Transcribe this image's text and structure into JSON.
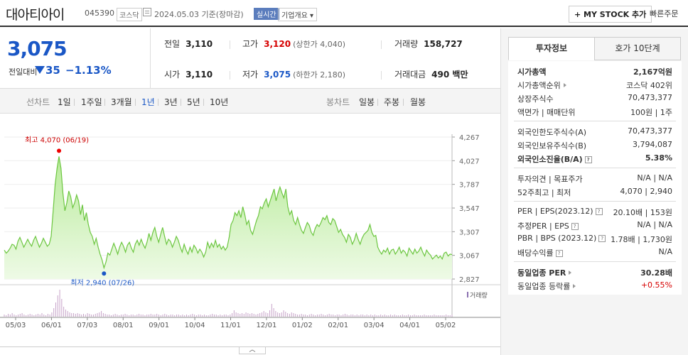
{
  "header": {
    "name": "대아티아이",
    "code": "045390",
    "market": "코스닥",
    "date": "2024.05.03",
    "basis": "기준(장마감)",
    "realtime": "실시간",
    "overview": "기업개요 ▾",
    "mystock": "+ MY STOCK 추가",
    "quick_order": "빠른주문"
  },
  "price": {
    "current": "3,075",
    "change_label": "전일대비",
    "change": "35",
    "change_pct": "−1.13%",
    "prev_label": "전일",
    "prev": "3,110",
    "high_label": "고가",
    "high": "3,120",
    "upper_limit": "(상한가 4,040)",
    "volume_label": "거래량",
    "volume": "158,727",
    "open_label": "시가",
    "open": "3,110",
    "low_label": "저가",
    "low": "3,075",
    "lower_limit": "(하한가 2,180)",
    "amount_label": "거래대금",
    "amount": "490 백만"
  },
  "periods": {
    "line_label": "선차트",
    "line": [
      "1일",
      "1주일",
      "3개월",
      "1년",
      "3년",
      "5년",
      "10년"
    ],
    "active": "1년",
    "candle_label": "봉차트",
    "candle": [
      "일봉",
      "주봉",
      "월봉"
    ]
  },
  "chart_data": {
    "type": "area",
    "y_ticks": [
      4267,
      4027,
      3787,
      3547,
      3307,
      3067,
      2827
    ],
    "ylim": [
      2827,
      4267
    ],
    "x_labels": [
      "05/03",
      "06/01",
      "07/03",
      "08/01",
      "09/01",
      "10/04",
      "11/01",
      "12/01",
      "01/02",
      "02/01",
      "03/04",
      "04/01",
      "05/02"
    ],
    "high_annotation": "최고 4,070 (06/19)",
    "low_annotation": "최저 2,940 (07/26)",
    "volume_legend": "거래량",
    "series": [
      {
        "name": "",
        "values": [
          3120,
          3090,
          3110,
          3140,
          3180,
          3170,
          3130,
          3210,
          3250,
          3200,
          3150,
          3190,
          3230,
          3190,
          3160,
          3220,
          3260,
          3200,
          3150,
          3190,
          3240,
          3200,
          3160,
          3180,
          3260,
          3520,
          3780,
          3950,
          4070,
          3950,
          3700,
          3520,
          3600,
          3720,
          3660,
          3550,
          3600,
          3680,
          3620,
          3480,
          3580,
          3420,
          3500,
          3380,
          3300,
          3260,
          3180,
          3240,
          3150,
          3080,
          3020,
          2940,
          3000,
          3090,
          3070,
          3130,
          3190,
          3140,
          3080,
          3150,
          3200,
          3160,
          3100,
          3170,
          3200,
          3140,
          3100,
          3180,
          3220,
          3170,
          3230,
          3180,
          3140,
          3200,
          3290,
          3220,
          3300,
          3350,
          3260,
          3200,
          3280,
          3350,
          3260,
          3180,
          3230,
          3210,
          3150,
          3200,
          3260,
          3220,
          3150,
          3100,
          3180,
          3120,
          3080,
          3150,
          3100,
          3170,
          3140,
          3090,
          3130,
          3100,
          3050,
          3100,
          3200,
          3140,
          3190,
          3150,
          3220,
          3150,
          3180,
          3130,
          3160,
          3120,
          3150,
          3250,
          3380,
          3420,
          3500,
          3470,
          3520,
          3450,
          3560,
          3480,
          3380,
          3420,
          3320,
          3280,
          3350,
          3420,
          3470,
          3560,
          3540,
          3600,
          3640,
          3560,
          3620,
          3680,
          3740,
          3620,
          3700,
          3760,
          3700,
          3650,
          3740,
          3560,
          3480,
          3520,
          3420,
          3380,
          3450,
          3380,
          3320,
          3290,
          3350,
          3400,
          3370,
          3300,
          3270,
          3340,
          3380,
          3360,
          3400,
          3450,
          3430,
          3470,
          3400,
          3380,
          3440,
          3420,
          3360,
          3300,
          3330,
          3280,
          3250,
          3200,
          3280,
          3250,
          3180,
          3220,
          3290,
          3230,
          3180,
          3240,
          3280,
          3300,
          3320,
          3380,
          3300,
          3260,
          3270,
          3150,
          3110,
          3080,
          3120,
          3100,
          3140,
          3080,
          3120,
          3130,
          3080,
          3110,
          3150,
          3090,
          3120,
          3100,
          3060,
          3140,
          3110,
          3080,
          3130,
          3090,
          3110,
          3150,
          3100,
          3060,
          3120,
          3090,
          3070,
          3030,
          3050,
          3070,
          3040,
          3060,
          3030,
          3090,
          3100,
          3060,
          3080,
          3075
        ]
      }
    ],
    "volume": [
      3,
      2,
      4,
      3,
      5,
      3,
      2,
      3,
      4,
      5,
      3,
      2,
      3,
      4,
      3,
      2,
      3,
      4,
      3,
      5,
      3,
      2,
      4,
      3,
      6,
      12,
      20,
      30,
      38,
      25,
      14,
      10,
      8,
      6,
      5,
      5,
      4,
      5,
      4,
      3,
      4,
      3,
      5,
      4,
      3,
      3,
      4,
      5,
      6,
      8,
      5,
      4,
      3,
      3,
      2,
      3,
      4,
      3,
      2,
      3,
      3,
      4,
      3,
      2,
      3,
      3,
      2,
      3,
      4,
      3,
      3,
      2,
      3,
      3,
      4,
      3,
      3,
      4,
      3,
      2,
      3,
      4,
      3,
      2,
      3,
      3,
      2,
      3,
      3,
      2,
      3,
      2,
      3,
      2,
      3,
      4,
      3,
      2,
      3,
      3,
      2,
      3,
      2,
      2,
      3,
      4,
      3,
      3,
      2,
      3,
      2,
      3,
      3,
      2,
      3,
      5,
      9,
      6,
      5,
      4,
      5,
      4,
      6,
      5,
      4,
      5,
      4,
      3,
      4,
      5,
      6,
      8,
      6,
      5,
      9,
      18,
      12,
      8,
      6,
      5,
      6,
      9,
      7,
      5,
      4,
      6,
      5,
      4,
      3,
      3,
      4,
      3,
      3,
      2,
      3,
      4,
      3,
      2,
      3,
      3,
      4,
      3,
      2,
      3,
      4,
      3,
      3,
      2,
      3,
      3,
      2,
      3,
      4,
      3,
      2,
      3,
      3,
      2,
      3,
      2,
      3,
      3,
      2,
      3,
      2,
      3,
      2,
      3,
      2,
      2,
      3,
      2,
      3,
      2,
      2,
      3,
      2,
      3,
      2,
      2,
      2,
      3,
      2,
      2,
      3,
      2,
      2,
      3,
      2,
      2,
      2,
      2,
      3,
      2,
      2,
      2,
      2,
      3,
      2,
      2,
      2,
      2,
      2,
      3,
      2,
      2,
      3
    ]
  },
  "panel": {
    "tab_info": "투자정보",
    "tab_hoga": "호가 10단계",
    "groups": [
      [
        {
          "k": "시가총액",
          "v": "2,167억원",
          "bold": true
        },
        {
          "k": "시가총액순위",
          "v": "코스닥 402위",
          "tri": true
        },
        {
          "k": "상장주식수",
          "v": "70,473,377"
        },
        {
          "k": "액면가 | 매매단위",
          "v": "100원 | 1주"
        }
      ],
      [
        {
          "k": "외국인한도주식수(A)",
          "v": "70,473,377"
        },
        {
          "k": "외국인보유주식수(B)",
          "v": "3,794,087"
        },
        {
          "k": "외국인소진율(B/A)",
          "v": "5.38%",
          "bold": true,
          "q": true
        }
      ],
      [
        {
          "k": "투자의견 | 목표주가",
          "v": "N/A | N/A"
        },
        {
          "k": "52주최고 | 최저",
          "v": "4,070 | 2,940"
        }
      ],
      [
        {
          "k": "PER | EPS(2023.12)",
          "v": "20.10배 | 153원",
          "q": true
        },
        {
          "k": "추정PER | EPS",
          "v": "N/A | N/A",
          "q": true
        },
        {
          "k": "PBR | BPS (2023.12)",
          "v": "1.78배 | 1,730원",
          "q": true
        },
        {
          "k": "배당수익률",
          "v": "N/A",
          "q": true
        }
      ],
      [
        {
          "k": "동일업종 PER",
          "v": "30.28배",
          "bold": true,
          "tri": true
        },
        {
          "k": "동일업종 등락률",
          "v": "+0.55%",
          "tri": true,
          "red": true
        }
      ]
    ]
  }
}
